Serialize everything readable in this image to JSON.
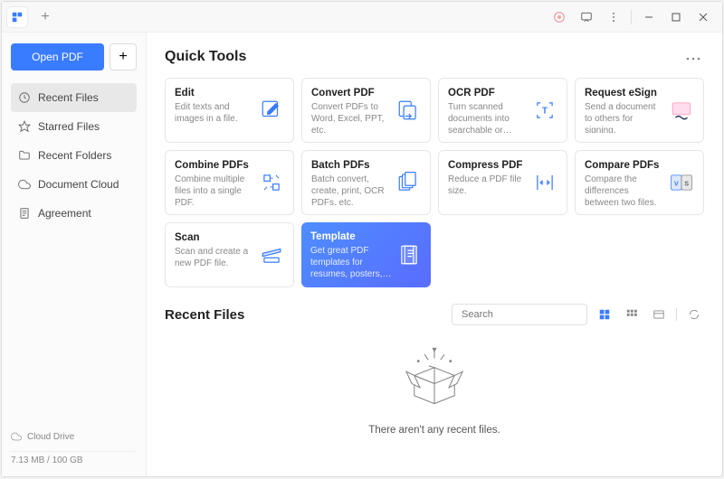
{
  "titlebar": {
    "plus": "+"
  },
  "sidebar": {
    "openLabel": "Open PDF",
    "plusLabel": "+",
    "nav": [
      {
        "label": "Recent Files",
        "icon": "clock",
        "active": true
      },
      {
        "label": "Starred Files",
        "icon": "star",
        "active": false
      },
      {
        "label": "Recent Folders",
        "icon": "folder",
        "active": false
      },
      {
        "label": "Document Cloud",
        "icon": "cloud",
        "active": false
      },
      {
        "label": "Agreement",
        "icon": "doc",
        "active": false
      }
    ],
    "cloudDrive": "Cloud Drive",
    "storage": "7.13 MB / 100 GB"
  },
  "quickTools": {
    "title": "Quick Tools",
    "tools": [
      {
        "title": "Edit",
        "desc": "Edit texts and images in a file.",
        "icon": "edit"
      },
      {
        "title": "Convert PDF",
        "desc": "Convert PDFs to Word, Excel, PPT, etc.",
        "icon": "convert"
      },
      {
        "title": "OCR PDF",
        "desc": "Turn scanned documents into searchable or editab...",
        "icon": "ocr"
      },
      {
        "title": "Request eSign",
        "desc": "Send a document to others for signing.",
        "icon": "esign"
      },
      {
        "title": "Combine PDFs",
        "desc": "Combine multiple files into a single PDF.",
        "icon": "combine"
      },
      {
        "title": "Batch PDFs",
        "desc": "Batch convert, create, print, OCR PDFs, etc.",
        "icon": "batch"
      },
      {
        "title": "Compress PDF",
        "desc": "Reduce a PDF file size.",
        "icon": "compress"
      },
      {
        "title": "Compare PDFs",
        "desc": "Compare the differences between two files.",
        "icon": "compare"
      },
      {
        "title": "Scan",
        "desc": "Scan and create a new PDF file.",
        "icon": "scan"
      },
      {
        "title": "Template",
        "desc": "Get great PDF templates for resumes, posters, etc.",
        "icon": "template",
        "highlight": true
      }
    ]
  },
  "recent": {
    "title": "Recent Files",
    "searchPlaceholder": "Search",
    "emptyText": "There aren't any recent files."
  }
}
